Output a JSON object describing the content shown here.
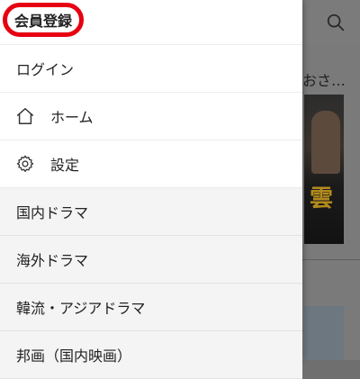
{
  "background": {
    "section_title_fragment": "おさ…",
    "poster_kanji": "雲"
  },
  "drawer": {
    "member_register_label": "会員登録",
    "items": [
      {
        "label": "ログイン",
        "icon": null
      },
      {
        "label": "ホーム",
        "icon": "home-icon"
      },
      {
        "label": "設定",
        "icon": "gear-icon"
      },
      {
        "label": "国内ドラマ",
        "icon": null
      },
      {
        "label": "海外ドラマ",
        "icon": null
      },
      {
        "label": "韓流・アジアドラマ",
        "icon": null
      },
      {
        "label": "邦画（国内映画）",
        "icon": null
      }
    ]
  },
  "colors": {
    "highlight_circle": "#e60012",
    "overlay": "#7a7a7a",
    "category_background": "#f4f4f4"
  }
}
